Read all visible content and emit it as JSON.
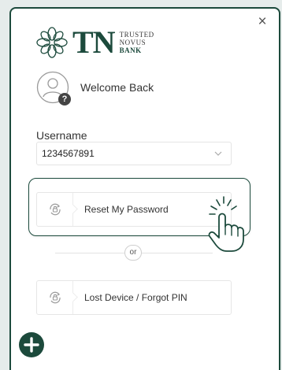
{
  "dialog": {
    "close_glyph": "×"
  },
  "brand": {
    "abbr": "TN",
    "line1": "TRUSTED",
    "line2": "NOVUS",
    "line3": "BANK",
    "color": "#1c4a3c"
  },
  "welcome": {
    "text": "Welcome Back",
    "badge": "?"
  },
  "username": {
    "label": "Username",
    "value": "1234567891"
  },
  "options": [
    {
      "label": "Reset My Password",
      "icon": "refresh-lock-icon"
    },
    {
      "label": "Lost Device / Forgot PIN",
      "icon": "refresh-lock-icon"
    }
  ],
  "separator": {
    "text": "or"
  },
  "fab": {
    "icon": "plus-icon"
  }
}
